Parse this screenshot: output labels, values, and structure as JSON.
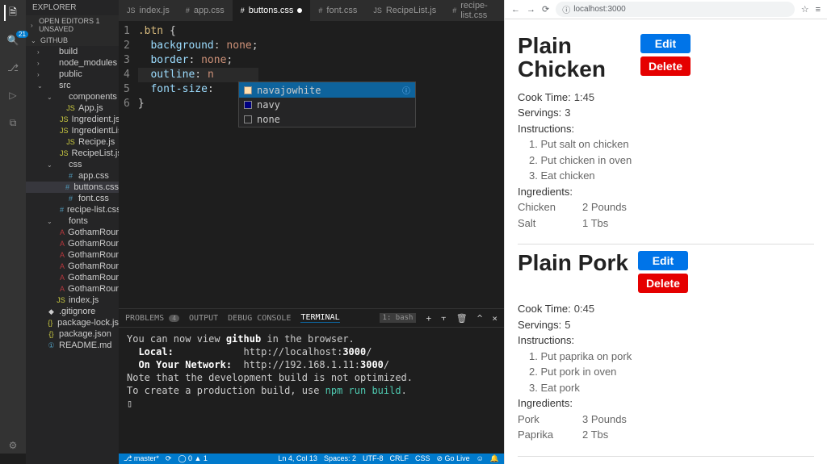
{
  "vscode": {
    "explorer_label": "EXPLORER",
    "open_editors": "OPEN EDITORS    1 UNSAVED",
    "root": "GITHUB",
    "tree": [
      {
        "depth": 1,
        "kind": "folder",
        "chev": "›",
        "label": "build"
      },
      {
        "depth": 1,
        "kind": "folder",
        "chev": "›",
        "label": "node_modules"
      },
      {
        "depth": 1,
        "kind": "folder",
        "chev": "›",
        "label": "public"
      },
      {
        "depth": 1,
        "kind": "folder",
        "chev": "⌄",
        "label": "src"
      },
      {
        "depth": 2,
        "kind": "folder",
        "chev": "⌄",
        "label": "components"
      },
      {
        "depth": 3,
        "kind": "js",
        "label": "App.js"
      },
      {
        "depth": 3,
        "kind": "js",
        "label": "Ingredient.js"
      },
      {
        "depth": 3,
        "kind": "js",
        "label": "IngredientLis"
      },
      {
        "depth": 3,
        "kind": "js",
        "label": "Recipe.js"
      },
      {
        "depth": 3,
        "kind": "js",
        "label": "RecipeList.js"
      },
      {
        "depth": 2,
        "kind": "folder",
        "chev": "⌄",
        "label": "css"
      },
      {
        "depth": 3,
        "kind": "css",
        "label": "app.css"
      },
      {
        "depth": 3,
        "kind": "css",
        "label": "buttons.css",
        "sel": true
      },
      {
        "depth": 3,
        "kind": "css",
        "label": "font.css"
      },
      {
        "depth": 3,
        "kind": "css",
        "label": "recipe-list.css"
      },
      {
        "depth": 2,
        "kind": "folder",
        "chev": "⌄",
        "label": "fonts"
      },
      {
        "depth": 3,
        "kind": "font",
        "label": "GothamRoun"
      },
      {
        "depth": 3,
        "kind": "font",
        "label": "GothamRoun"
      },
      {
        "depth": 3,
        "kind": "font",
        "label": "GothamRoun"
      },
      {
        "depth": 3,
        "kind": "font",
        "label": "GothamRoun"
      },
      {
        "depth": 3,
        "kind": "font",
        "label": "GothamRoun"
      },
      {
        "depth": 3,
        "kind": "font",
        "label": "GothamRoun"
      },
      {
        "depth": 2,
        "kind": "js",
        "label": "index.js"
      },
      {
        "depth": 1,
        "kind": "file",
        "label": ".gitignore"
      },
      {
        "depth": 1,
        "kind": "json",
        "label": "package-lock.js"
      },
      {
        "depth": 1,
        "kind": "json",
        "label": "package.json"
      },
      {
        "depth": 1,
        "kind": "md",
        "label": "README.md"
      }
    ],
    "tabs": [
      {
        "label": "index.js",
        "icon": "JS"
      },
      {
        "label": "app.css",
        "icon": "#"
      },
      {
        "label": "buttons.css",
        "icon": "#",
        "active": true,
        "dirty": true
      },
      {
        "label": "font.css",
        "icon": "#"
      },
      {
        "label": "RecipeList.js",
        "icon": "JS"
      },
      {
        "label": "recipe-list.css",
        "icon": "#"
      }
    ],
    "code": {
      "lines": [
        {
          "n": 1,
          "html": "<span class='tok-sel'>.btn</span> <span class='tok-punc'>{</span>"
        },
        {
          "n": 2,
          "html": "  <span class='tok-prop'>background</span><span class='tok-punc'>:</span> <span class='tok-val'>none</span><span class='tok-punc'>;</span>"
        },
        {
          "n": 3,
          "html": "  <span class='tok-prop'>border</span><span class='tok-punc'>:</span> <span class='tok-val'>none</span><span class='tok-punc'>;</span>"
        },
        {
          "n": 4,
          "html": "  <span class='tok-prop'>outline</span><span class='tok-punc'>:</span> <span class='tok-val'>n</span>",
          "cur": true
        },
        {
          "n": 5,
          "html": "  <span class='tok-prop'>font-size</span><span class='tok-punc'>:</span>"
        },
        {
          "n": 6,
          "html": "<span class='tok-punc'>}</span>"
        }
      ]
    },
    "intellisense": [
      {
        "label": "navajowhite",
        "swatch": "navajowhite",
        "sel": true,
        "info": true
      },
      {
        "label": "navy",
        "swatch": "navy"
      },
      {
        "label": "none",
        "swatch": ""
      }
    ],
    "panel": {
      "tabs": [
        "PROBLEMS",
        "OUTPUT",
        "DEBUG CONSOLE",
        "TERMINAL"
      ],
      "problems_badge": "4",
      "selector": "1: bash",
      "terminal_lines": [
        "You can now view <span class='bold'>github</span> in the browser.",
        "",
        "  <span class='bold'>Local:</span>            http://localhost:<span class='bold'>3000</span>/",
        "  <span class='bold'>On Your Network:</span>  http://192.168.1.11:<span class='bold'>3000</span>/",
        "",
        "Note that the development build is not optimized.",
        "To create a production build, use <span style='color:#4ec9b0'>npm run build</span>.",
        "",
        "▯"
      ]
    },
    "statusbar": {
      "left": [
        "⎇ master*",
        "⟳",
        "◯ 0 ▲ 1"
      ],
      "right": [
        "Ln 4, Col 13",
        "Spaces: 2",
        "UTF-8",
        "CRLF",
        "CSS",
        "⊘ Go Live",
        "☺",
        "🔔"
      ]
    },
    "badge": "21"
  },
  "browser": {
    "url": "localhost:3000",
    "recipes": [
      {
        "title": "Plain Chicken",
        "edit": "Edit",
        "delete": "Delete",
        "cook_label": "Cook Time:",
        "cook": "1:45",
        "serv_label": "Servings:",
        "serv": "3",
        "instr_label": "Instructions:",
        "instructions": [
          "1. Put salt on chicken",
          "2. Put chicken in oven",
          "3. Eat chicken"
        ],
        "ingr_label": "Ingredients:",
        "ingredients": [
          [
            "Chicken",
            "2 Pounds"
          ],
          [
            "Salt",
            "1 Tbs"
          ]
        ]
      },
      {
        "title": "Plain Pork",
        "edit": "Edit",
        "delete": "Delete",
        "cook_label": "Cook Time:",
        "cook": "0:45",
        "serv_label": "Servings:",
        "serv": "5",
        "instr_label": "Instructions:",
        "instructions": [
          "1. Put paprika on pork",
          "2. Put pork in oven",
          "3. Eat pork"
        ],
        "ingr_label": "Ingredients:",
        "ingredients": [
          [
            "Pork",
            "3 Pounds"
          ],
          [
            "Paprika",
            "2 Tbs"
          ]
        ]
      }
    ]
  }
}
